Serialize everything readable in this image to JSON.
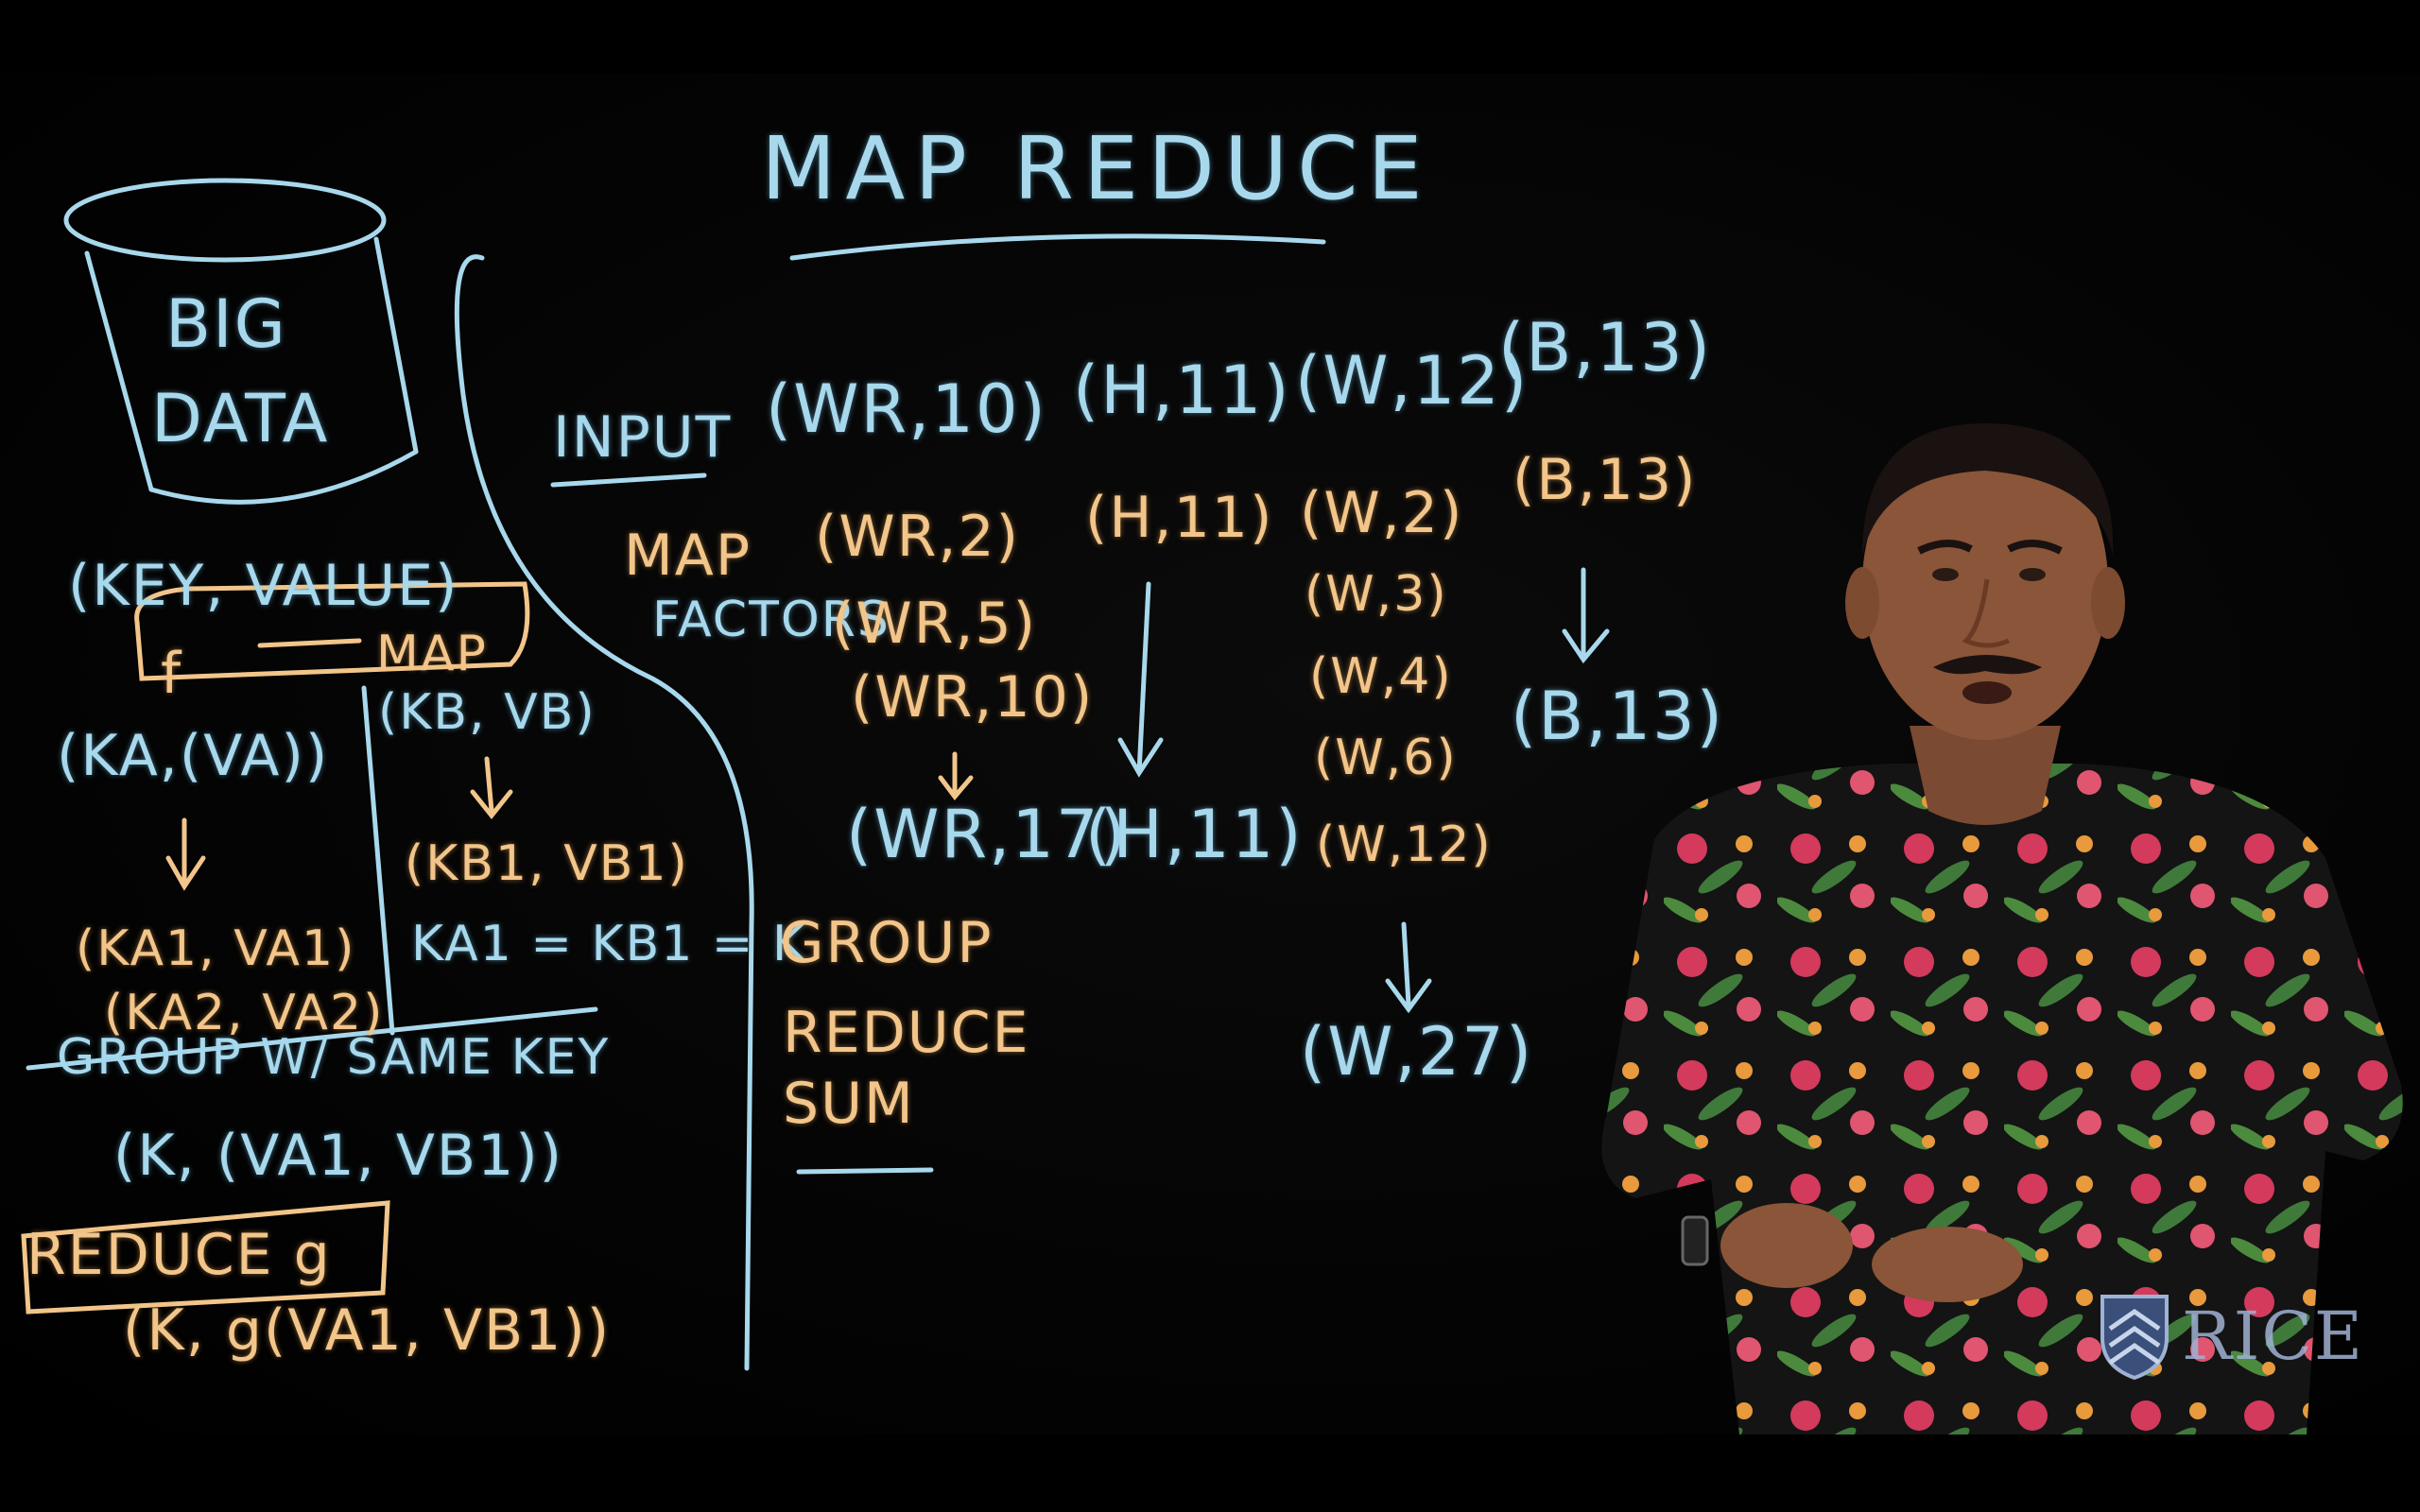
{
  "board": {
    "title": "MAP REDUCE",
    "left": {
      "big": "BIG",
      "data": "DATA",
      "key_value": "(KEY, VALUE)",
      "f": "f",
      "map": "MAP",
      "ka_va": "(KA,(VA))",
      "kb_vb": "(KB, VB)",
      "kb1_vb1": "(KB1, VB1)",
      "ka1_va1": "(KA1, VA1)",
      "ka2_va2": "(KA2, VA2)",
      "ka_eq": "KA1 = KB1 = K",
      "group_same_key": "GROUP W/ SAME KEY",
      "k_va_vb": "(K, (VA1, VB1))",
      "reduce_g": "REDUCE g",
      "k_g": "(K, g(VA1, VB1))"
    },
    "labels": {
      "input": "INPUT",
      "map": "MAP",
      "factors": "FACTORS",
      "group": "GROUP",
      "reduce": "REDUCE",
      "sum": "SUM"
    },
    "columns": {
      "wr": {
        "input": "(WR,10)",
        "map": [
          "(WR,2)",
          "(WR,5)",
          "(WR,10)"
        ],
        "result": "(WR,17)"
      },
      "h": {
        "input": "(H,11)",
        "map": [
          "(H,11)"
        ],
        "result": "(H,11)"
      },
      "w": {
        "input": "(W,12)",
        "map": [
          "(W,2)",
          "(W,3)",
          "(W,4)",
          "(W,6)",
          "(W,12)"
        ],
        "result": "(W,27)"
      },
      "b": {
        "input": "(B,13)",
        "map": [
          "(B,13)"
        ],
        "result": "(B,13)"
      }
    }
  },
  "logo": {
    "text": "RICE",
    "icon": "rice-shield-icon"
  },
  "colors": {
    "blue_chalk": "#a8d8ec",
    "orange_chalk": "#f2c58a",
    "shirt": "#1a1a1a"
  }
}
